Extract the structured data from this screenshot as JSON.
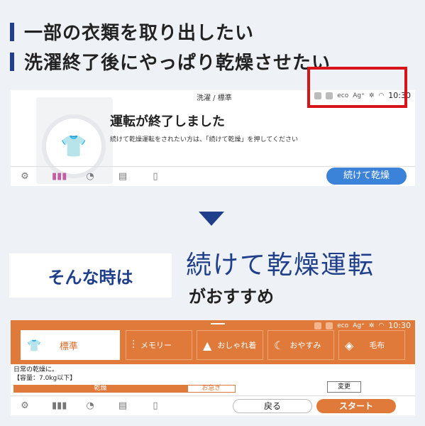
{
  "headings": [
    "一部の衣類を取り出したい",
    "洗濯終了後にやっぱり乾燥させたい"
  ],
  "screen1": {
    "mode": "洗濯 / 標準",
    "status_icons": [
      "eco",
      "Ag⁺"
    ],
    "time": "10:30",
    "title": "運転が終了しました",
    "message": "続けて乾燥運転をされたい方は、「続けて乾燥」を押してください",
    "continue_label": "続けて乾燥"
  },
  "when": "そんな時は",
  "recommend": {
    "big": "続けて乾燥運転",
    "small": "がおすすめ"
  },
  "screen2": {
    "time": "10:30",
    "status_icons": [
      "eco",
      "Ag⁺"
    ],
    "courses": [
      {
        "label": "標準",
        "icon": "shirt-icon"
      },
      {
        "label": "メモリー",
        "icon": "sliders-icon"
      },
      {
        "label": "おしゃれ着",
        "icon": "dress-icon"
      },
      {
        "label": "おやすみ",
        "icon": "moon-icon"
      },
      {
        "label": "毛布",
        "icon": "blanket-icon"
      }
    ],
    "desc_line1": "日常の乾燥に。",
    "desc_line2": "【容量：7.0kg以下】",
    "mode_dry": "乾燥",
    "mode_quick": "お急ぎ",
    "change_label": "変更",
    "back_label": "戻る",
    "start_label": "スタート"
  },
  "colors": {
    "accent_blue": "#1f3f8a",
    "button_blue": "#3b82d9",
    "orange": "#e07a3a",
    "red": "#d7141a"
  }
}
